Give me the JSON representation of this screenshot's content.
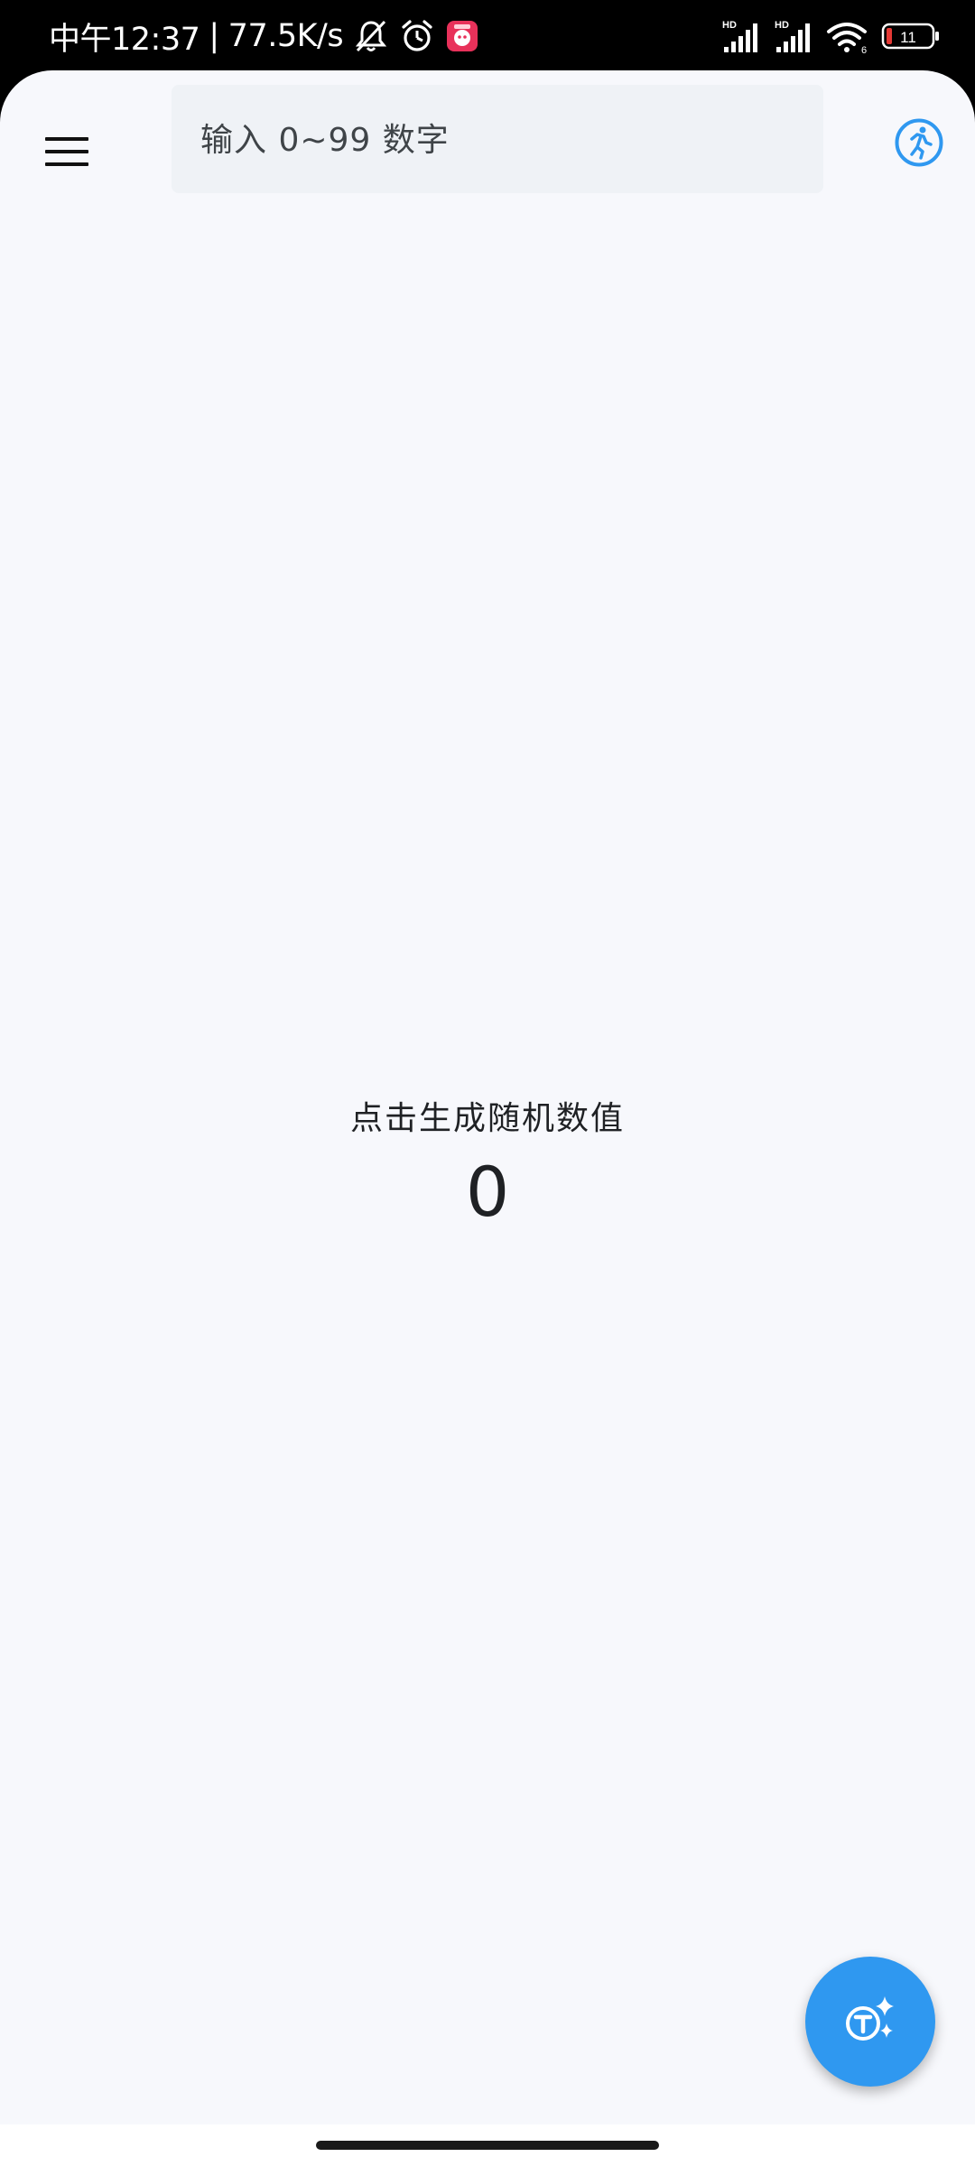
{
  "status_bar": {
    "time": "中午12:37",
    "separator": "|",
    "network_speed": "77.5K/s",
    "left_icons": [
      "bell-off-icon",
      "alarm-icon",
      "app-notification-icon"
    ],
    "signal_labels": [
      "HD",
      "HD"
    ],
    "wifi_badge": "6",
    "battery_level": "11",
    "battery_color": "#e53935"
  },
  "header": {
    "menu_icon": "menu-icon",
    "search_placeholder": "输入 0~99 数字",
    "search_value": "",
    "action_icon": "running-person-icon"
  },
  "main": {
    "prompt": "点击生成随机数值",
    "value": "0"
  },
  "fab": {
    "icon": "translate-sparkle-icon"
  },
  "colors": {
    "accent": "#2f98f0",
    "background": "#f7f8fc",
    "search_background": "#eff2f6",
    "text": "#1f2124"
  }
}
